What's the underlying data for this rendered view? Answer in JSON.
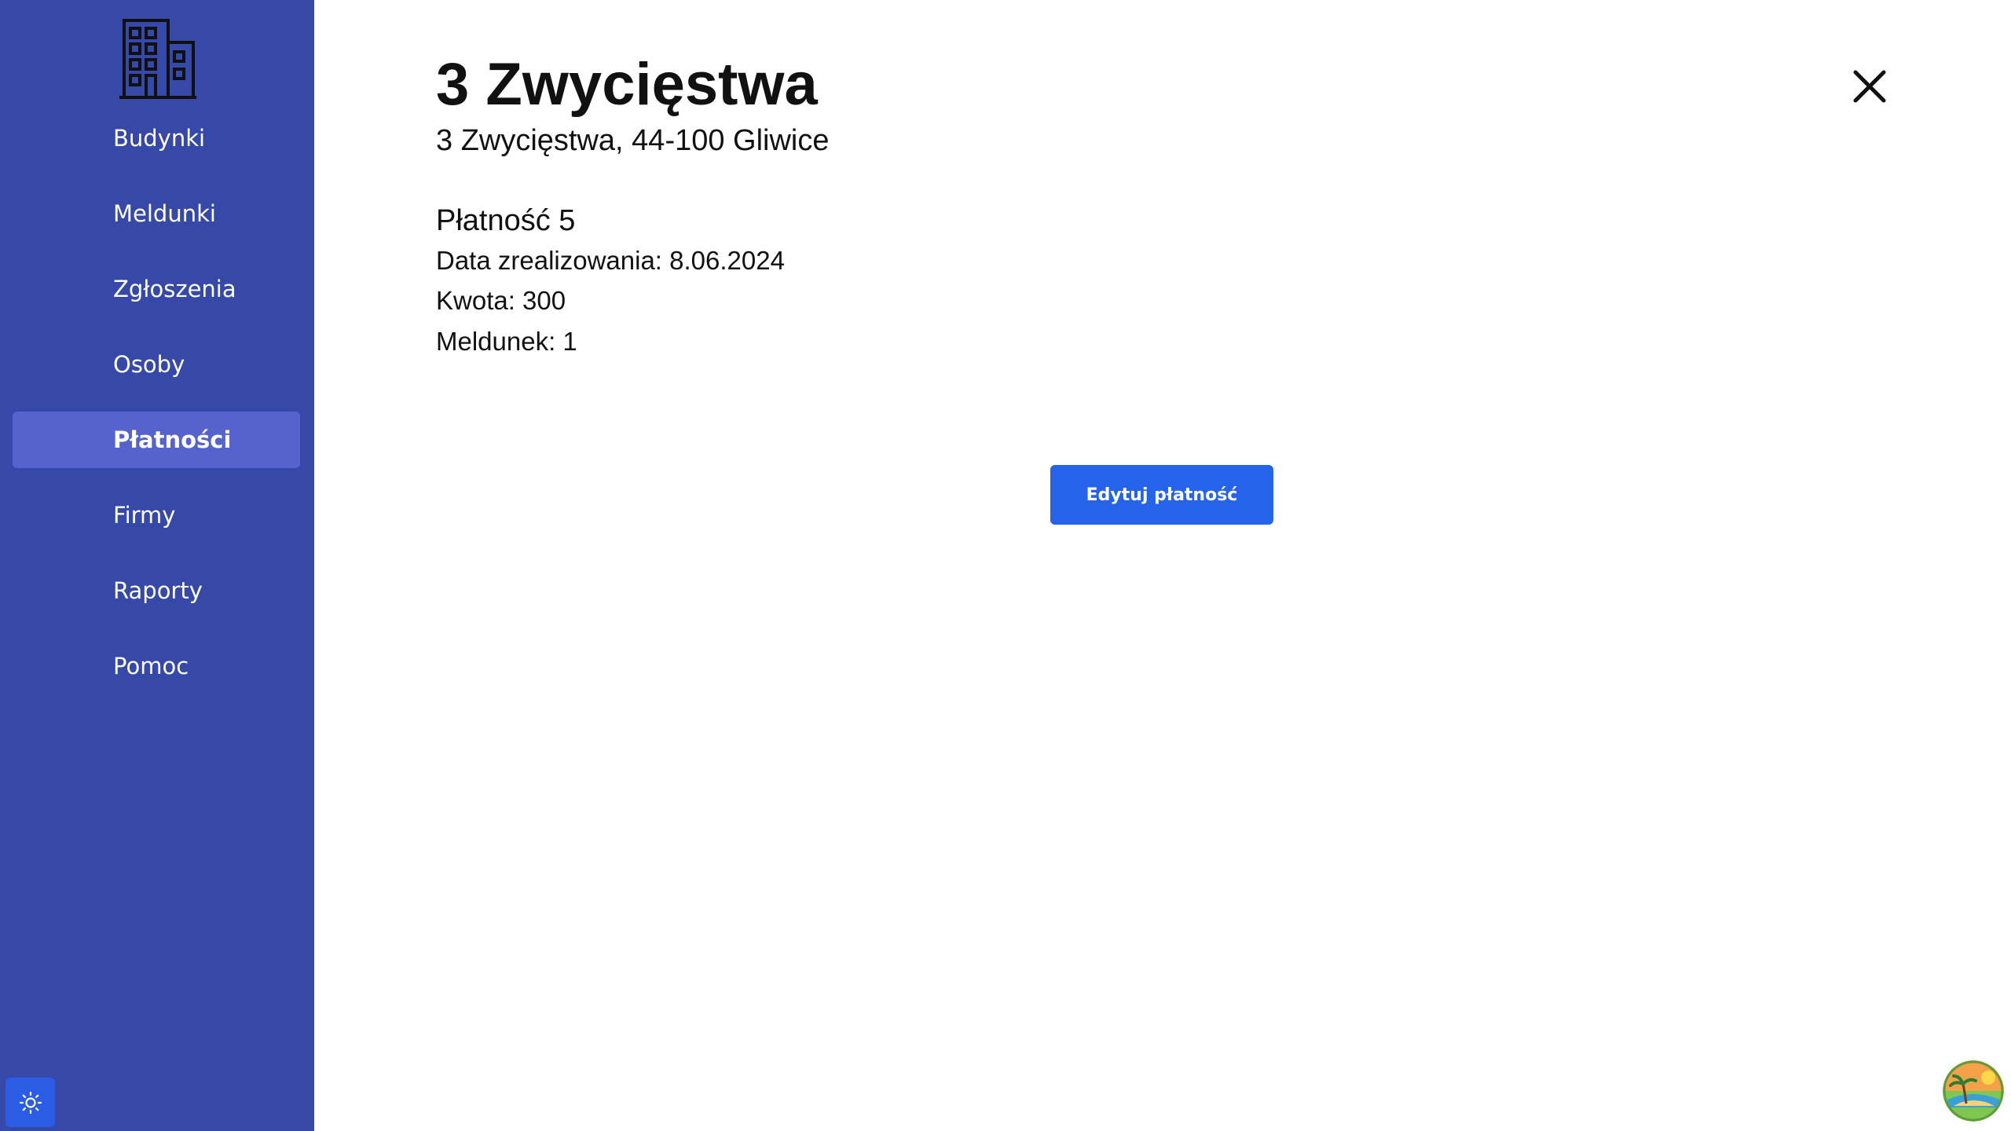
{
  "sidebar": {
    "logo_icon": "building-icon",
    "items": [
      {
        "label": "Budynki",
        "active": false
      },
      {
        "label": "Meldunki",
        "active": false
      },
      {
        "label": "Zgłoszenia",
        "active": false
      },
      {
        "label": "Osoby",
        "active": false
      },
      {
        "label": "Płatności",
        "active": true
      },
      {
        "label": "Firmy",
        "active": false
      },
      {
        "label": "Raporty",
        "active": false
      },
      {
        "label": "Pomoc",
        "active": false
      }
    ],
    "theme_toggle_icon": "sun-icon"
  },
  "main": {
    "title": "3 Zwycięstwa",
    "subtitle": "3 Zwycięstwa, 44-100 Gliwice",
    "payment": {
      "title": "Płatność 5",
      "date": "Data zrealizowania: 8.06.2024",
      "amount": "Kwota: 300",
      "registration": "Meldunek: 1"
    },
    "edit_button_label": "Edytuj płatność",
    "close_icon": "close-icon"
  },
  "colors": {
    "sidebar_bg": "#3648a8",
    "active_item_bg": "#5663cf",
    "primary_button": "#2563eb"
  }
}
